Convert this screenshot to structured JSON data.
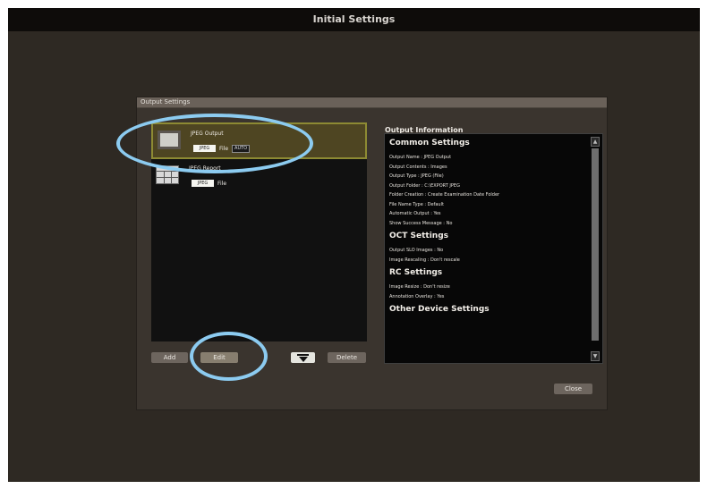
{
  "window": {
    "title": "Initial Settings"
  },
  "dialog": {
    "header": "Output Settings",
    "outputs": [
      {
        "name": "JPEG Output",
        "format": "JPEG",
        "type": "File",
        "auto": "AUTO",
        "icon": "monitor-icon",
        "selected": true
      },
      {
        "name": "JPEG Report",
        "format": "JPEG",
        "type": "File",
        "icon": "report-grid-icon",
        "selected": false
      }
    ],
    "buttons": {
      "add": "Add",
      "edit": "Edit",
      "filter_icon": "filter-down-icon",
      "delete": "Delete",
      "close": "Close"
    },
    "info": {
      "title": "Output Information",
      "sections": [
        {
          "title": "Common Settings",
          "lines": [
            "Output Name : JPEG Output",
            "Output Contents : Images",
            "Output Type : JPEG (File)",
            "Output Folder : C:\\EXPORT JPEG",
            "Folder Creation : Create Examination Date Folder",
            "File Name Type : Default",
            "Automatic Output : Yes",
            "Show Success Message : No"
          ]
        },
        {
          "title": "OCT Settings",
          "lines": [
            "Output SLO Images : No",
            "Image Rescaling : Don't rescale"
          ]
        },
        {
          "title": "RC Settings",
          "lines": [
            "Image Resize : Don't resize",
            "Annotation Overlay : Yes"
          ]
        },
        {
          "title": "Other Device Settings",
          "lines": []
        }
      ],
      "scroll_up_icon": "chevron-up-icon",
      "scroll_down_icon": "chevron-down-icon"
    }
  },
  "colors": {
    "background": "#2e2923",
    "title_bar": "#0e0c0a",
    "dialog": "#3a342e",
    "selected_item": "#4e4522",
    "selected_border": "#8d8a33",
    "highlight_ring": "#8ccbf0"
  }
}
